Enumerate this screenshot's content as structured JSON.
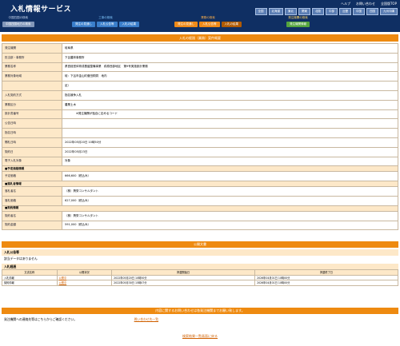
{
  "app": {
    "title": "入札情報サービス"
  },
  "top_links": [
    "ヘルプ",
    "お問い合わせ",
    "全国版TOP"
  ],
  "regions": [
    "全国",
    "北海道",
    "東北",
    "関東",
    "北陸",
    "中部",
    "近畿",
    "中国",
    "四国",
    "九州沖縄"
  ],
  "nav_groups": [
    {
      "label": "中国四国の検索",
      "tabs": [
        "中国四国地方の検索"
      ]
    },
    {
      "label": "工事の検索",
      "tabs": [
        "発注の見通し",
        "入札公告等",
        "入札の結果"
      ]
    },
    {
      "label": "業務の検索",
      "tabs": [
        "発注の見通し",
        "入札公告等",
        "入札の結果"
      ]
    },
    {
      "label": "発注機関の検索",
      "tabs": [
        "発注機関情報"
      ]
    }
  ],
  "section_title": "入札の経過（業務）案件概要",
  "detail_rows": [
    {
      "k": "発注機関",
      "v": "岐阜県"
    },
    {
      "k": "担当部・事務所",
      "v": "下呂農林事務所"
    },
    {
      "k": "業務名称",
      "v": "県営経営体育成基盤整備事業　萩原西部地区　第9号実施設計業務"
    },
    {
      "k": "業務対象地域",
      "v": "岐：下呂市金山町菅田桐洞　地内"
    },
    {
      "k": "",
      "v": "足）"
    },
    {
      "k": "入札契約方式",
      "v": "指名競争入札"
    },
    {
      "k": "業務区分",
      "v": "農業土木"
    },
    {
      "k": "設計書番号",
      "v": "　　　　※発注機関が独自に定めるコード"
    },
    {
      "k": "公告日時",
      "v": ""
    },
    {
      "k": "指名日時",
      "v": ""
    },
    {
      "k": "開札日時",
      "v": "2022年05月20日 10時50分"
    },
    {
      "k": "契約日",
      "v": "2022年05月23日"
    },
    {
      "k": "電子入札対象",
      "v": "対象"
    }
  ],
  "estimate_header": "■予定価格情報",
  "estimate_rows": [
    {
      "k": "予定価格",
      "v": "666,600（税込み）"
    }
  ],
  "lowest_header": "■落札者情報",
  "lowest_rows": [
    {
      "k": "落札者名",
      "v": "（株）興栄コンサルタント"
    },
    {
      "k": "落札価格",
      "v": "627,000（税込み）"
    }
  ],
  "contract_header": "■契約情報",
  "contract_rows": [
    {
      "k": "契約者名",
      "v": "（株）興栄コンサルタント"
    },
    {
      "k": "契約金額",
      "v": "591,000（税込み）"
    }
  ],
  "public_docs": {
    "title": "公開文書",
    "notice_label": "入札公告等",
    "notice_value": "該当データはありません",
    "history_label": "入札経過",
    "columns": [
      "文書名称",
      "公開状況",
      "掲載開始日",
      "掲載終了日"
    ],
    "rows": [
      {
        "name": "入札情報",
        "status": "公開中",
        "start": "2022年05月20日 10時50分",
        "end": "2026年04月01日 10時00分"
      },
      {
        "name": "契約情報",
        "status": "公開中",
        "start": "2022年05月30日 15時07分",
        "end": "2026年04月01日 10時00分"
      }
    ]
  },
  "contact": {
    "bar": "内容に関するお問い合わせは各発注機関までお願い致します。",
    "text": "発注機関への連絡先等はこちらからご確認ください。",
    "link": "問い合わせ先一覧"
  },
  "back_link": "検索結果一覧画面に戻る",
  "colors": {
    "header": "#0f2f63",
    "accent": "#ee8a10",
    "key_cell": "#fde8c8"
  }
}
